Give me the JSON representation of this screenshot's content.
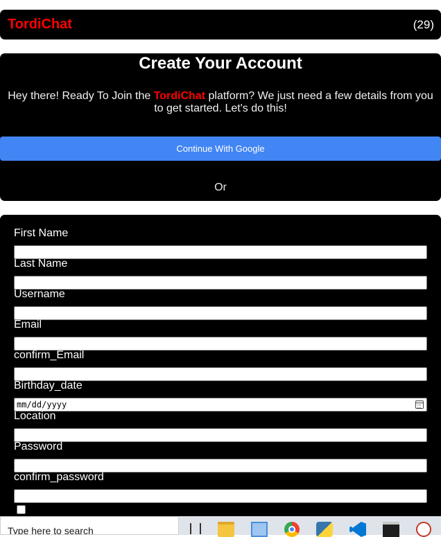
{
  "header": {
    "brand": "TordiChat",
    "count": "(29)"
  },
  "intro": {
    "title": "Create Your Account",
    "text_before": "Hey there! Ready To Join the ",
    "text_highlight": "TordiChat",
    "text_after": " platform? We just need a few details from you to get started. Let's do this!",
    "google_button": "Continue With Google",
    "or": "Or"
  },
  "form": {
    "first_name": "First Name",
    "last_name": "Last Name",
    "username": "Username",
    "email": "Email",
    "confirm_email": "confirm_Email",
    "birthday": "Birthday_date",
    "birthday_placeholder": "mm/dd/yyyy",
    "location": "Location",
    "password": "Password",
    "confirm_password": "confirm_password"
  },
  "taskbar": {
    "search_placeholder": "Type here to search"
  },
  "colors": {
    "accent": "#ff0000",
    "google": "#4285f4",
    "background": "#000000"
  }
}
